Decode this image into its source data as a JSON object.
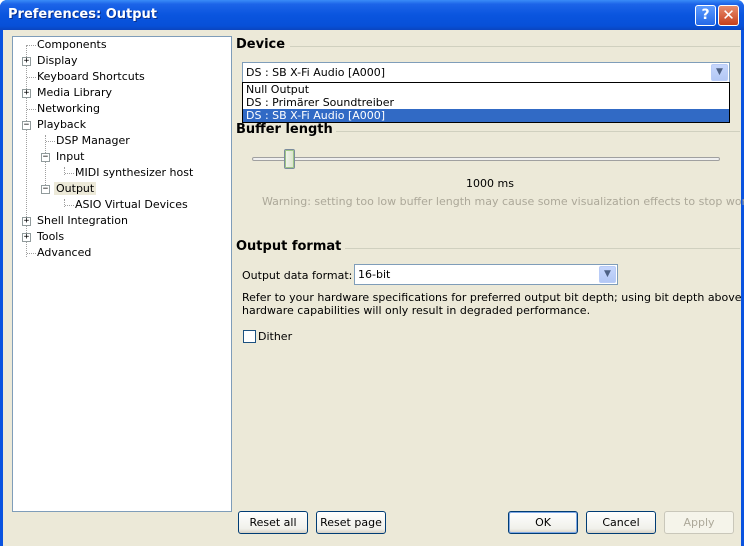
{
  "window": {
    "title": "Preferences: Output",
    "help_glyph": "?",
    "close_glyph": "✕"
  },
  "tree": {
    "items": [
      {
        "label": "Components"
      },
      {
        "label": "Display",
        "expander": "+"
      },
      {
        "label": "Keyboard Shortcuts"
      },
      {
        "label": "Media Library",
        "expander": "+"
      },
      {
        "label": "Networking"
      },
      {
        "label": "Playback",
        "expander": "−"
      },
      {
        "label": "DSP Manager"
      },
      {
        "label": "Input",
        "expander": "−"
      },
      {
        "label": "MIDI synthesizer host"
      },
      {
        "label": "Output",
        "expander": "−"
      },
      {
        "label": "ASIO Virtual Devices"
      },
      {
        "label": "Shell Integration",
        "expander": "+"
      },
      {
        "label": "Tools",
        "expander": "+"
      },
      {
        "label": "Advanced"
      }
    ]
  },
  "device": {
    "title": "Device",
    "selected": "DS : SB X-Fi Audio [A000]",
    "options": [
      "Null Output",
      "DS : Primärer Soundtreiber",
      "DS : SB X-Fi Audio [A000]"
    ]
  },
  "buffer": {
    "title": "Buffer length",
    "value_label": "1000 ms",
    "slider_fraction": 0.07,
    "warning": "Warning: setting too low buffer length may cause some visualization effects to stop working."
  },
  "output_format": {
    "title": "Output format",
    "data_format_label": "Output data format:",
    "data_format_value": "16-bit",
    "info_line1": "Refer to your hardware specifications for preferred output bit depth; using bit depth above your",
    "info_line2": "hardware capabilities will only result in degraded performance.",
    "dither_label": "Dither",
    "dither_checked": false
  },
  "buttons": {
    "reset_all": "Reset all",
    "reset_page": "Reset page",
    "ok": "OK",
    "cancel": "Cancel",
    "apply": "Apply"
  }
}
